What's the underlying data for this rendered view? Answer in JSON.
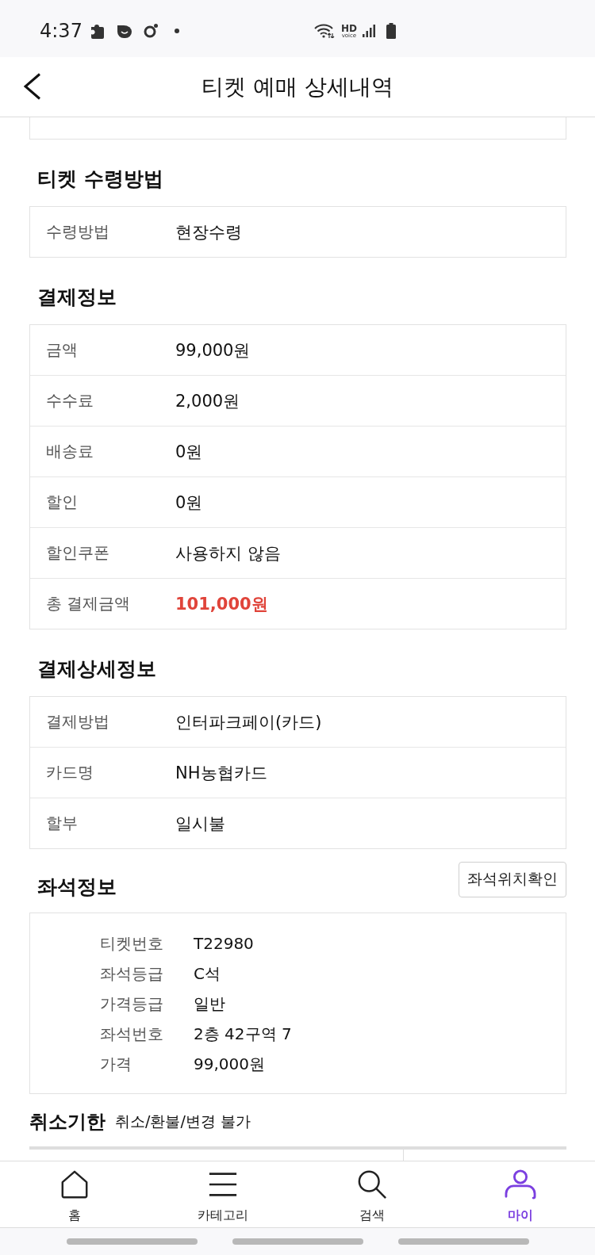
{
  "status_bar": {
    "time": "4:37",
    "network_badge": {
      "top": "HD",
      "bottom": "voice"
    }
  },
  "header": {
    "title": "티켓 예매 상세내역"
  },
  "sections": [
    {
      "title": "티켓 수령방법",
      "rows": [
        {
          "label": "수령방법",
          "value": "현장수령",
          "emphasis": false
        }
      ]
    },
    {
      "title": "결제정보",
      "rows": [
        {
          "label": "금액",
          "value": "99,000원",
          "emphasis": false
        },
        {
          "label": "수수료",
          "value": "2,000원",
          "emphasis": false
        },
        {
          "label": "배송료",
          "value": "0원",
          "emphasis": false
        },
        {
          "label": "할인",
          "value": "0원",
          "emphasis": false
        },
        {
          "label": "할인쿠폰",
          "value": "사용하지 않음",
          "emphasis": false
        },
        {
          "label": "총 결제금액",
          "value": "101,000원",
          "emphasis": true
        }
      ]
    },
    {
      "title": "결제상세정보",
      "rows": [
        {
          "label": "결제방법",
          "value": "인터파크페이(카드)",
          "emphasis": false
        },
        {
          "label": "카드명",
          "value": "NH농협카드",
          "emphasis": false
        },
        {
          "label": "할부",
          "value": "일시불",
          "emphasis": false
        }
      ]
    }
  ],
  "seat_info": {
    "title": "좌석정보",
    "button": "좌석위치확인",
    "rows": [
      {
        "label": "티켓번호",
        "value": "T22980"
      },
      {
        "label": "좌석등급",
        "value": "C석"
      },
      {
        "label": "가격등급",
        "value": "일반"
      },
      {
        "label": "좌석번호",
        "value": "2층 42구역 7"
      },
      {
        "label": "가격",
        "value": "99,000원"
      }
    ]
  },
  "cancel_deadline": {
    "title": "취소기한",
    "value": "취소/환불/변경 불가"
  },
  "bottom_nav": [
    {
      "label": "홈",
      "kind": "home",
      "selected": false
    },
    {
      "label": "카테고리",
      "kind": "menu",
      "selected": false
    },
    {
      "label": "검색",
      "kind": "search",
      "selected": false
    },
    {
      "label": "마이",
      "kind": "profile",
      "selected": true
    }
  ]
}
